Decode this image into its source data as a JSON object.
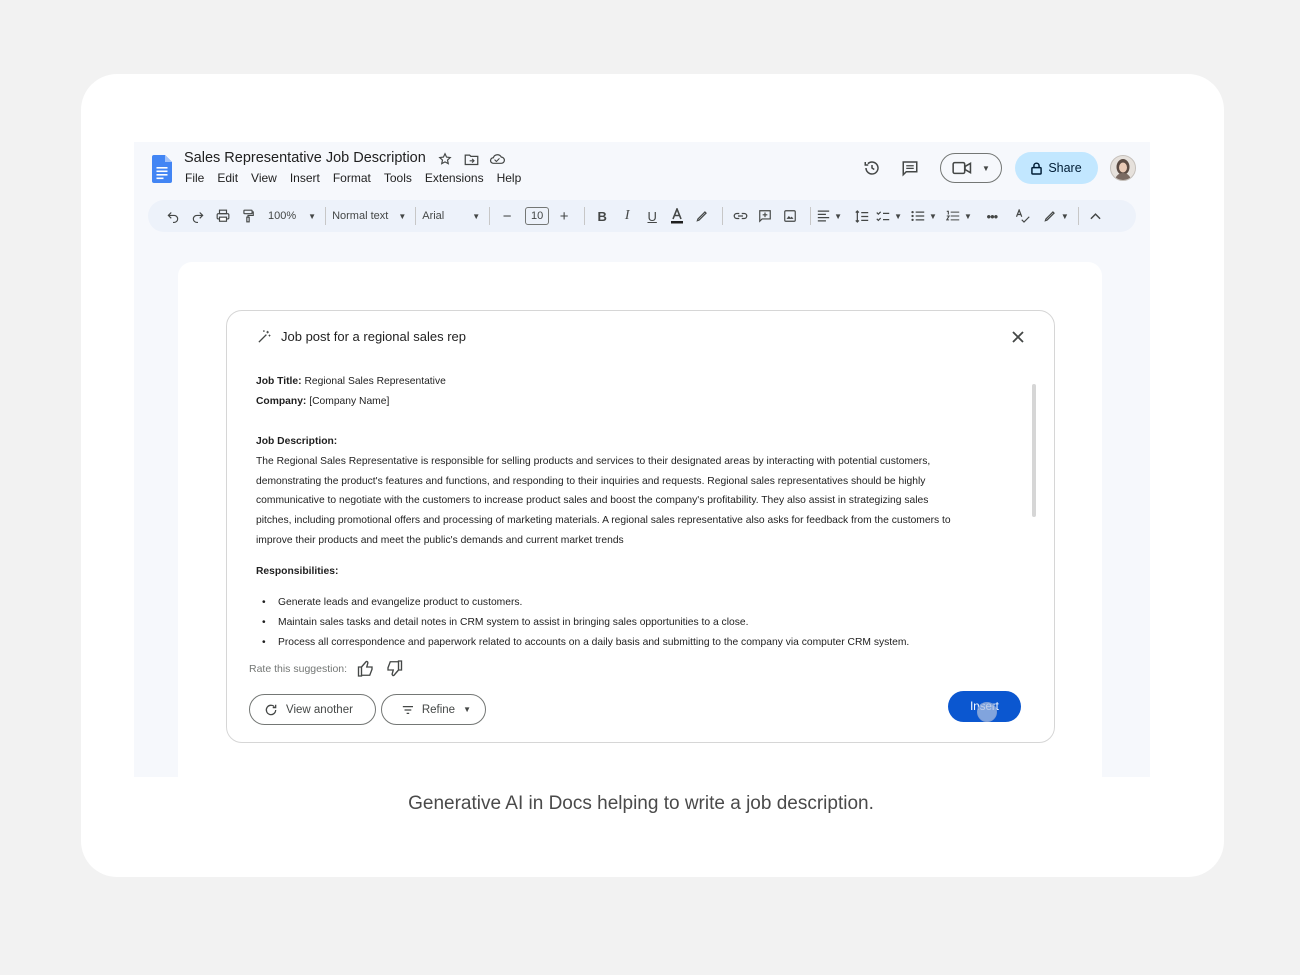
{
  "doc": {
    "title": "Sales Representative Job Description",
    "menu": [
      "File",
      "Edit",
      "View",
      "Insert",
      "Format",
      "Tools",
      "Extensions",
      "Help"
    ],
    "share_label": "Share"
  },
  "toolbar": {
    "zoom": "100%",
    "style": "Normal text",
    "font": "Arial",
    "font_size": "10"
  },
  "panel": {
    "prompt": "Job post for a regional sales rep",
    "job_title_label": "Job Title:",
    "job_title_value": "Regional Sales Representative",
    "company_label": "Company:",
    "company_value": "[Company Name]",
    "description_label": "Job Description:",
    "description_lines": [
      "The Regional Sales Representative is responsible for selling products and services to their designated areas by interacting with potential customers,",
      "demonstrating the product's features and functions, and responding to their inquiries and requests. Regional sales representatives should be highly",
      "communicative to negotiate with the customers to increase product sales and boost the company's profitability. They also assist in strategizing sales",
      "pitches, including promotional offers and processing of marketing materials. A regional sales representative also asks for feedback from the customers to",
      "improve their products and meet the public's demands and current market trends"
    ],
    "responsibilities_label": "Responsibilities:",
    "responsibilities": [
      "Generate leads and evangelize product to customers.",
      "Maintain sales tasks and detail notes in CRM system to assist in bringing sales opportunities to a close.",
      "Process all correspondence and paperwork related to accounts on a daily basis and submitting to the company via computer CRM system."
    ],
    "rate_label": "Rate this suggestion:",
    "view_another_label": "View another",
    "refine_label": "Refine",
    "insert_label": "Insert"
  },
  "caption": "Generative AI in Docs helping to write a job description.",
  "colors": {
    "primary": "#0b57d0",
    "share_bg": "#c2e7ff",
    "docs_blue": "#4285f4"
  }
}
